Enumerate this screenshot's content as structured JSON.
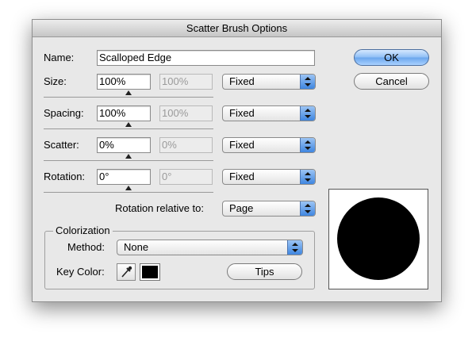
{
  "window": {
    "title": "Scatter Brush Options"
  },
  "name": {
    "label": "Name:",
    "value": "Scalloped Edge"
  },
  "rows": [
    {
      "label": "Size:",
      "value": "100%",
      "disabled_value": "100%",
      "mode": "Fixed",
      "slider_level": 0.5
    },
    {
      "label": "Spacing:",
      "value": "100%",
      "disabled_value": "100%",
      "mode": "Fixed",
      "slider_level": 0.5
    },
    {
      "label": "Scatter:",
      "value": "0%",
      "disabled_value": "0%",
      "mode": "Fixed",
      "slider_level": 0.5
    },
    {
      "label": "Rotation:",
      "value": "0°",
      "disabled_value": "0°",
      "mode": "Fixed",
      "slider_level": 0.5
    }
  ],
  "rotation_relative": {
    "label": "Rotation relative to:",
    "value": "Page"
  },
  "colorization": {
    "title": "Colorization",
    "method_label": "Method:",
    "method_value": "None",
    "key_color_label": "Key Color:",
    "key_color": "#000000",
    "tips_label": "Tips"
  },
  "buttons": {
    "ok": "OK",
    "cancel": "Cancel"
  },
  "colors": {
    "accent": "#6aa5ec",
    "preview_shape": "#000000"
  },
  "icons": {
    "eyedropper": "eyedropper-icon"
  }
}
